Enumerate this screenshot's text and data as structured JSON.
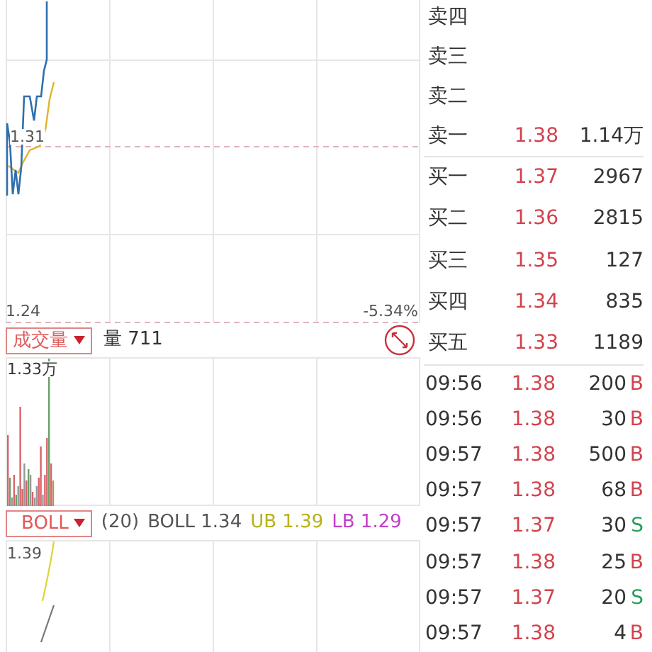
{
  "main_chart": {
    "price_label": "1.31",
    "low_label": "1.24",
    "change_label": "-5.34%"
  },
  "volume_panel": {
    "selector": "成交量",
    "reading": "量 711",
    "max_label": "1.33万"
  },
  "boll_panel": {
    "selector": "BOLL",
    "legend": [
      {
        "text": "(20)",
        "color": "#555555"
      },
      {
        "text": "BOLL 1.34",
        "color": "#555555"
      },
      {
        "text": "UB 1.39",
        "color": "#b8b21c"
      },
      {
        "text": "LB 1.29",
        "color": "#c23fc9"
      }
    ],
    "top_label": "1.39"
  },
  "order_book": {
    "asks": [
      {
        "label": "卖四"
      },
      {
        "label": "卖三"
      },
      {
        "label": "卖二"
      },
      {
        "label": "卖一",
        "price": "1.38",
        "volume": "1.14万"
      }
    ],
    "bids": [
      {
        "label": "买一",
        "price": "1.37",
        "volume": "2967"
      },
      {
        "label": "买二",
        "price": "1.36",
        "volume": "2815"
      },
      {
        "label": "买三",
        "price": "1.35",
        "volume": "127"
      },
      {
        "label": "买四",
        "price": "1.34",
        "volume": "835"
      },
      {
        "label": "买五",
        "price": "1.33",
        "volume": "1189"
      }
    ]
  },
  "trades": [
    {
      "time": "09:56",
      "price": "1.38",
      "volume": "200",
      "side": "B",
      "kind": "buy"
    },
    {
      "time": "09:56",
      "price": "1.38",
      "volume": "30",
      "side": "B",
      "kind": "buy"
    },
    {
      "time": "09:57",
      "price": "1.38",
      "volume": "500",
      "side": "B",
      "kind": "buy"
    },
    {
      "time": "09:57",
      "price": "1.38",
      "volume": "68",
      "side": "B",
      "kind": "buy"
    },
    {
      "time": "09:57",
      "price": "1.37",
      "volume": "30",
      "side": "S",
      "kind": "sell"
    },
    {
      "time": "09:57",
      "price": "1.38",
      "volume": "25",
      "side": "B",
      "kind": "buy"
    },
    {
      "time": "09:57",
      "price": "1.37",
      "volume": "20",
      "side": "S",
      "kind": "sell"
    },
    {
      "time": "09:57",
      "price": "1.38",
      "volume": "4",
      "side": "B",
      "kind": "buy"
    }
  ]
}
